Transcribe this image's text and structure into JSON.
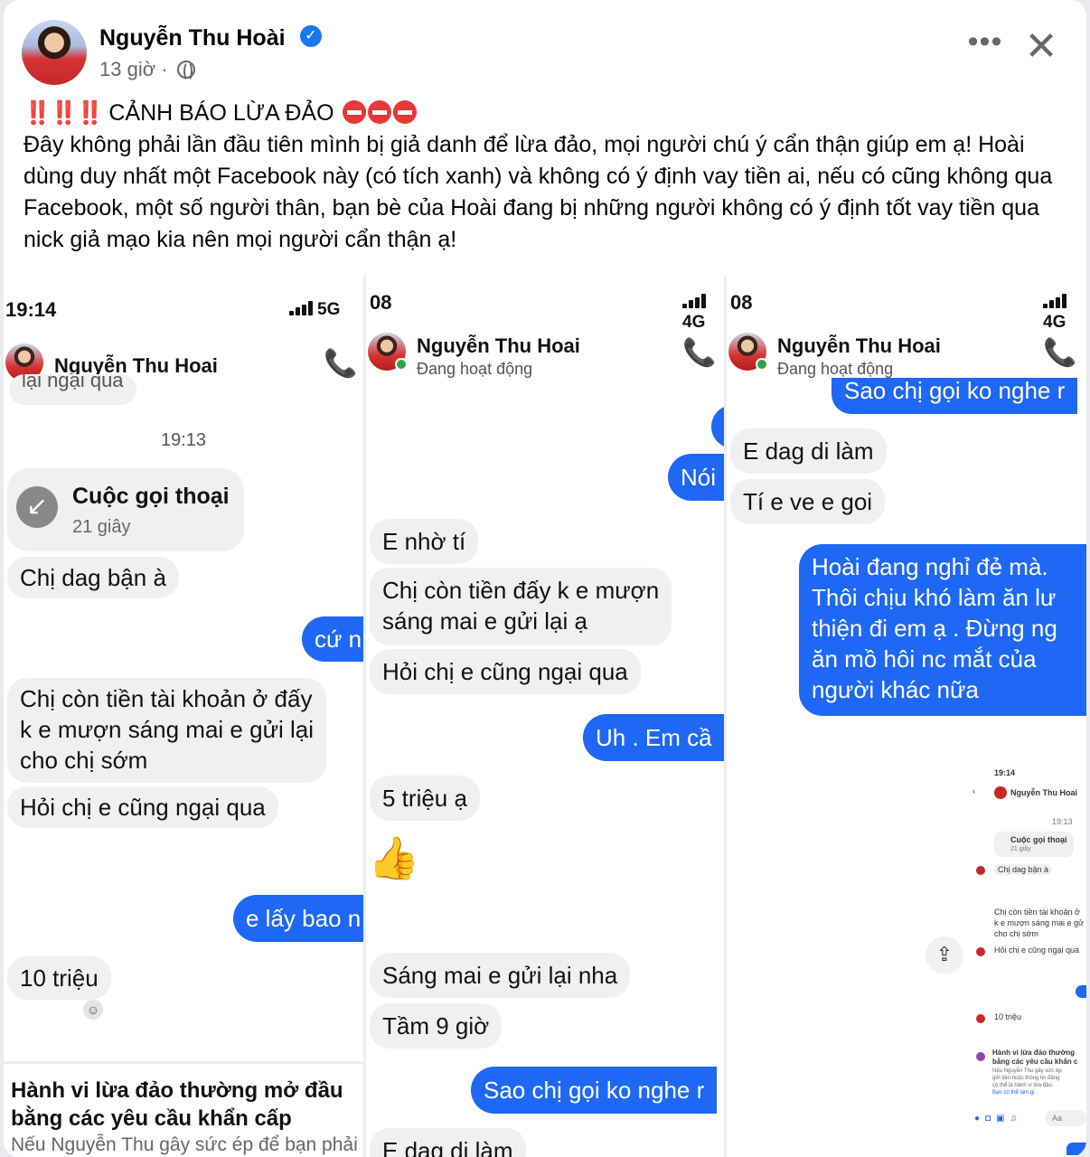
{
  "post": {
    "author": "Nguyễn Thu Hoài",
    "time": "13 giờ ·",
    "headline": "CẢNH BÁO LỪA ĐẢO",
    "headline_prefix": "‼️‼️‼️",
    "paragraph": "Đây không phải lần đầu tiên mình bị giả danh để lừa đảo, mọi người chú ý cẩn thận giúp em ạ! Hoài dùng duy nhất một Facebook này (có tích xanh) và không có ý định vay tiền ai, nếu có cũng không qua Facebook, một số người thân, bạn bè của Hoài đang bị những người không có ý định tốt vay tiền qua nick giả mạo kia nên mọi người cẩn thận ạ!"
  },
  "icons": {
    "verified": "✓",
    "more": "•••",
    "close": "✕",
    "phone": "📞",
    "like": "👍",
    "share": "⇪",
    "call": "↙"
  },
  "shot1": {
    "time": "19:14",
    "network": "5G",
    "name": "Nguyễn Thu Hoai",
    "partial_top": "lại ngại qua",
    "stamp": "19:13",
    "call_title": "Cuộc gọi thoại",
    "call_duration": "21 giây",
    "msg1": "Chị dag bận à",
    "out1": "cứ n",
    "msg2_l1": "Chị còn tiền tài khoản ở đấy",
    "msg2_l2": "k e mượn sáng mai e gửi lại",
    "msg2_l3": "cho chị sớm",
    "msg3": "Hỏi chị e cũng ngại qua",
    "out2": "e lấy bao n",
    "msg4": "10 triệu",
    "warn_title_l1": "Hành vi lừa đảo thường mở đầu",
    "warn_title_l2": "bằng các yêu cầu khẩn cấp",
    "warn_sub": "Nếu Nguyễn Thu gây sức ép để bạn phải"
  },
  "shot2": {
    "time": "08",
    "network": "4G",
    "name": "Nguyễn Thu Hoai",
    "status": "Đang hoạt động",
    "out_top": "Nói",
    "msg1": "E nhờ tí",
    "msg2_l1": "Chị còn tiền đấy k e mượn",
    "msg2_l2": "sáng mai e gửi lại ạ",
    "msg3": "Hỏi chị e cũng ngại qua",
    "out1": "Uh . Em cầ",
    "msg4": "5 triệu ạ",
    "msg5": "Sáng mai e gửi lại nha",
    "msg6": "Tầm 9 giờ",
    "out2": "Sao chị gọi ko nghe r",
    "msg7": "E dag di làm"
  },
  "shot3": {
    "time": "08",
    "network": "4G",
    "name": "Nguyễn Thu Hoai",
    "status": "Đang hoạt động",
    "out_top": "Sao chị gọi ko nghe r",
    "msg1": "E dag di làm",
    "msg2": "Tí e ve e goi",
    "out1_l1": "Hoài đang nghỉ đẻ mà.",
    "out1_l2": "Thôi chịu khó làm ăn lư",
    "out1_l3": "thiện đi em ạ . Đừng ng",
    "out1_l4": "ăn mồ hôi nc mắt của",
    "out1_l5": "người khác nữa",
    "thumb": {
      "time": "19:14",
      "name": "Nguyễn Thu Hoai",
      "stamp": "19:13",
      "call": "Cuộc gọi thoại",
      "dur": "21 giây",
      "m1": "Chị dag bận à",
      "m2a": "Chị còn tiền tài khoản ở",
      "m2b": "k e mượn sáng mai e gử",
      "m2c": "cho chị sớm",
      "m3": "Hỏi chị e cũng ngại qua",
      "m4": "10 triệu",
      "w1": "Hành vi lừa đảo thường",
      "w2": "bằng các yêu cầu khẩn c",
      "w3": "Nếu Nguyễn Thu gây sức ép",
      "w4": "gửi tiền hoặc thông tin đăng",
      "w5": "có thể là hành vi lừa đảo.",
      "w6": "Bạn có thể làm gì",
      "aa": "Aa"
    }
  },
  "colors": {
    "messenger_blue": "#1f68f5",
    "fb_blue": "#1877f2",
    "incoming_bubble": "#f0f0f0"
  }
}
